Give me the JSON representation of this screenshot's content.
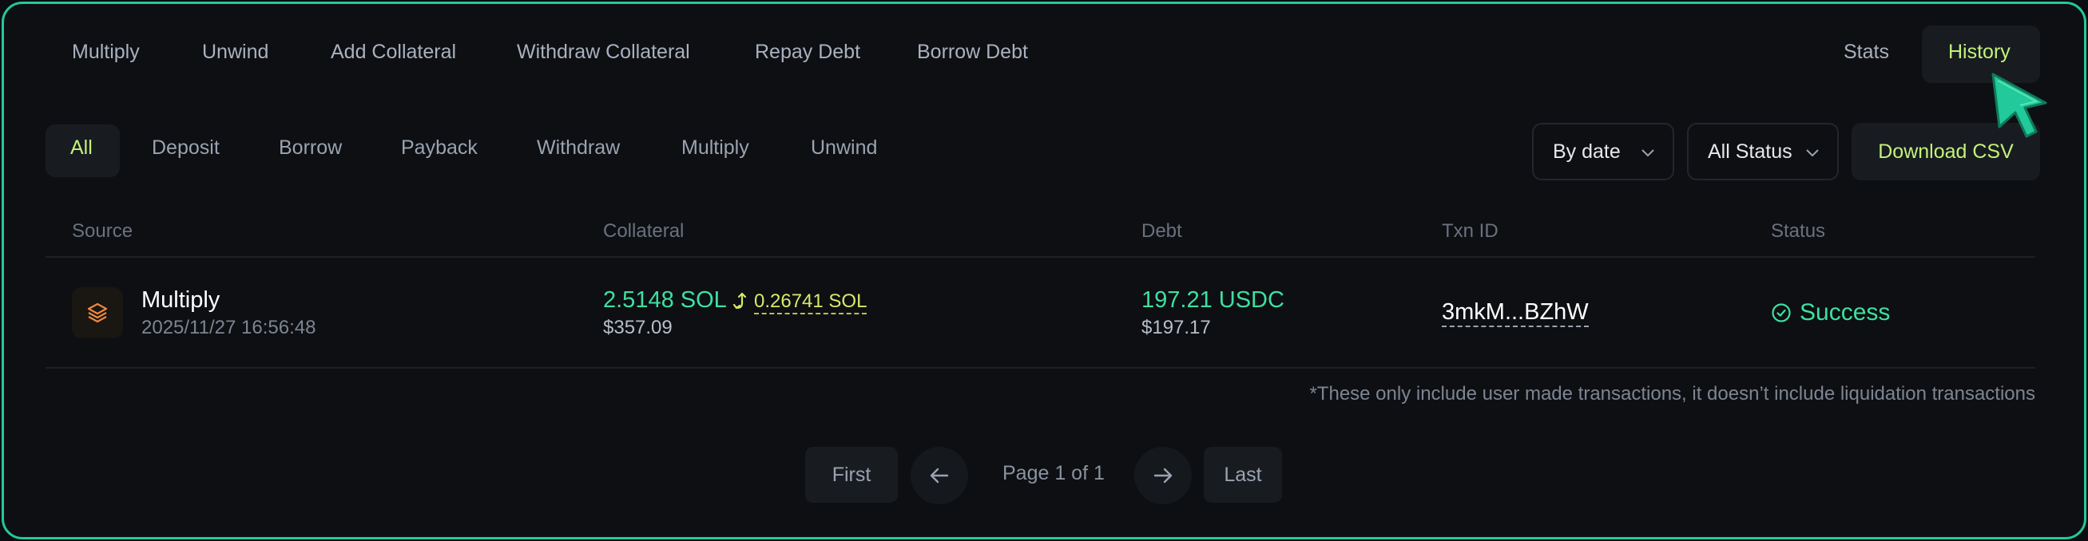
{
  "top_tabs": {
    "multiply": "Multiply",
    "unwind": "Unwind",
    "add_collateral": "Add Collateral",
    "withdraw_collateral": "Withdraw Collateral",
    "repay_debt": "Repay Debt",
    "borrow_debt": "Borrow Debt",
    "stats": "Stats",
    "history": "History"
  },
  "filters": {
    "all": "All",
    "deposit": "Deposit",
    "borrow": "Borrow",
    "payback": "Payback",
    "withdraw": "Withdraw",
    "multiply": "Multiply",
    "unwind": "Unwind"
  },
  "controls": {
    "sort_label": "By date",
    "status_label": "All Status",
    "download_label": "Download CSV"
  },
  "table": {
    "headers": {
      "source": "Source",
      "collateral": "Collateral",
      "debt": "Debt",
      "txn_id": "Txn ID",
      "status": "Status"
    },
    "rows": [
      {
        "source": "Multiply",
        "timestamp": "2025/11/27 16:56:48",
        "collateral_amount": "2.5148 SOL",
        "collateral_change": "0.26741 SOL",
        "collateral_usd": "$357.09",
        "debt_amount": "197.21 USDC",
        "debt_usd": "$197.17",
        "txn_id": "3mkM...BZhW",
        "status": "Success"
      }
    ]
  },
  "note": "*These only include user made transactions, it doesn’t include liquidation transactions",
  "pagination": {
    "first": "First",
    "last": "Last",
    "page_info": "Page 1 of 1"
  },
  "colors": {
    "accent": "#c4f27a",
    "success": "#3fe0a0",
    "border": "#22c99a",
    "change": "#d9e86a"
  },
  "icons": [
    "layers-icon",
    "loop-arrow-icon",
    "check-circle-icon",
    "chevron-down-icon",
    "arrow-left-icon",
    "arrow-right-icon",
    "cursor-icon"
  ]
}
